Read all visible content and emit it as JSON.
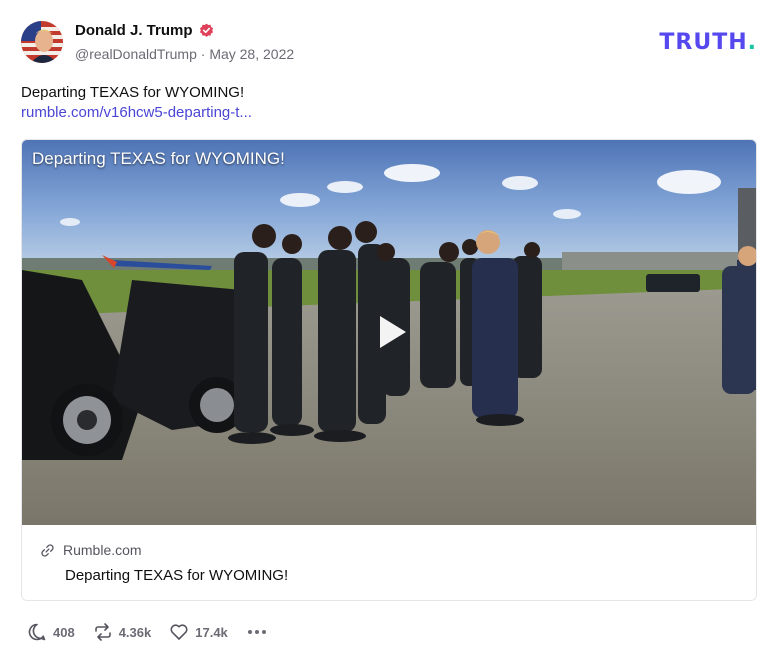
{
  "author": {
    "display_name": "Donald J. Trump",
    "handle": "@realDonaldTrump",
    "separator": "·",
    "date": "May 28, 2022",
    "verified": true
  },
  "brand": {
    "name": "TRUTH",
    "dot": ".",
    "color": "#5448ee",
    "dot_color": "#17c3a0"
  },
  "post": {
    "text": "Departing TEXAS for WYOMING!",
    "link": "rumble.com/v16hcw5-departing-t..."
  },
  "card": {
    "video_overlay_title": "Departing TEXAS for WYOMING!",
    "source": "Rumble.com",
    "title": "Departing TEXAS for WYOMING!",
    "icons": {
      "link": "link-icon",
      "play": "play-icon"
    }
  },
  "actions": {
    "replies": "408",
    "retruths": "4.36k",
    "likes": "17.4k",
    "icons": [
      "reply-icon",
      "retruth-icon",
      "heart-icon",
      "more-icon"
    ]
  },
  "colors": {
    "accent": "#5448ee",
    "verified": "#e0415a",
    "link": "#4b45d6",
    "muted": "#6b6b75"
  }
}
